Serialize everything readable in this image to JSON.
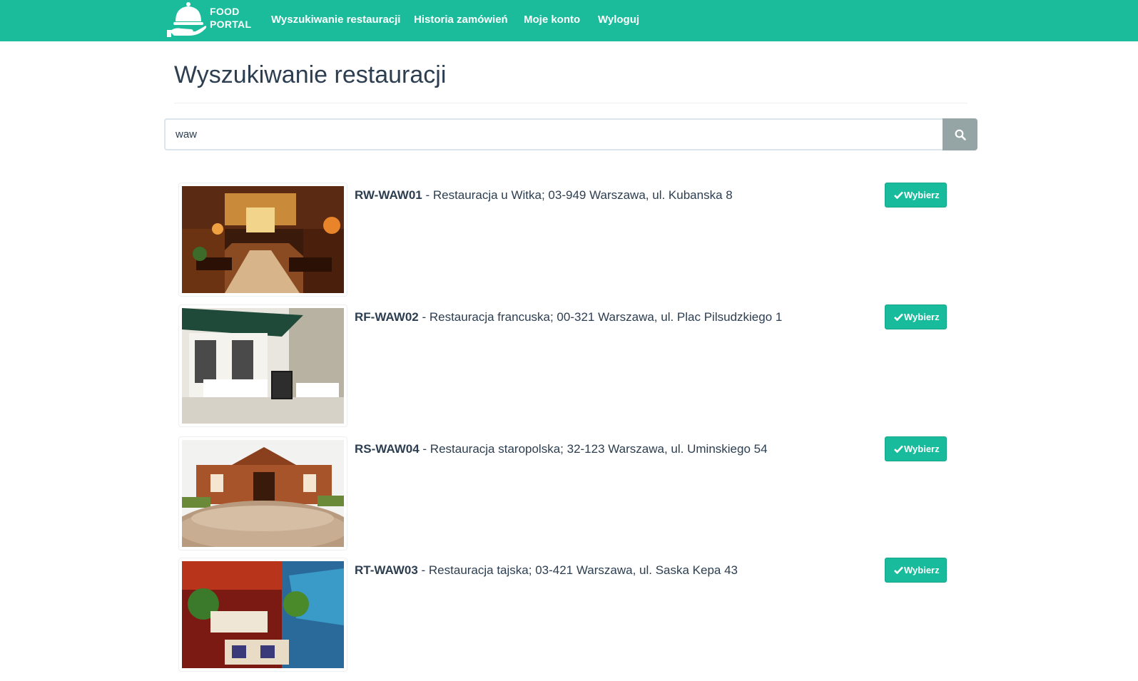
{
  "brand": {
    "line1": "FOOD",
    "line2": "PORTAL",
    "logo_icon": "cloche-icon"
  },
  "nav": [
    {
      "label": "Wyszukiwanie restauracji"
    },
    {
      "label": "Historia zamówień"
    },
    {
      "label": "Moje konto"
    },
    {
      "label": "Wyloguj"
    }
  ],
  "colors": {
    "navbar": "#1abc9c",
    "accent": "#18bc9c",
    "search_button": "#95a5a6",
    "text": "#2c3e50"
  },
  "page": {
    "title": "Wyszukiwanie restauracji"
  },
  "search": {
    "value": "waw",
    "icon": "search-icon"
  },
  "results": [
    {
      "code": "RW-WAW01",
      "description": " - Restauracja u Witka; 03-949 Warszawa, ul. Kubanska 8",
      "button": "Wybierz",
      "image": "restaurant-interior"
    },
    {
      "code": "RF-WAW02",
      "description": " - Restauracja francuska; 00-321 Warszawa, ul. Plac Pilsudzkiego 1",
      "button": "Wybierz",
      "image": "trattoria-terrace"
    },
    {
      "code": "RS-WAW04",
      "description": " - Restauracja staropolska; 32-123 Warszawa, ul. Uminskiego 54",
      "button": "Wybierz",
      "image": "brick-building"
    },
    {
      "code": "RT-WAW03",
      "description": " - Restauracja tajska; 03-421 Warszawa, ul. Saska Kepa 43",
      "button": "Wybierz",
      "image": "thai-interior"
    }
  ]
}
